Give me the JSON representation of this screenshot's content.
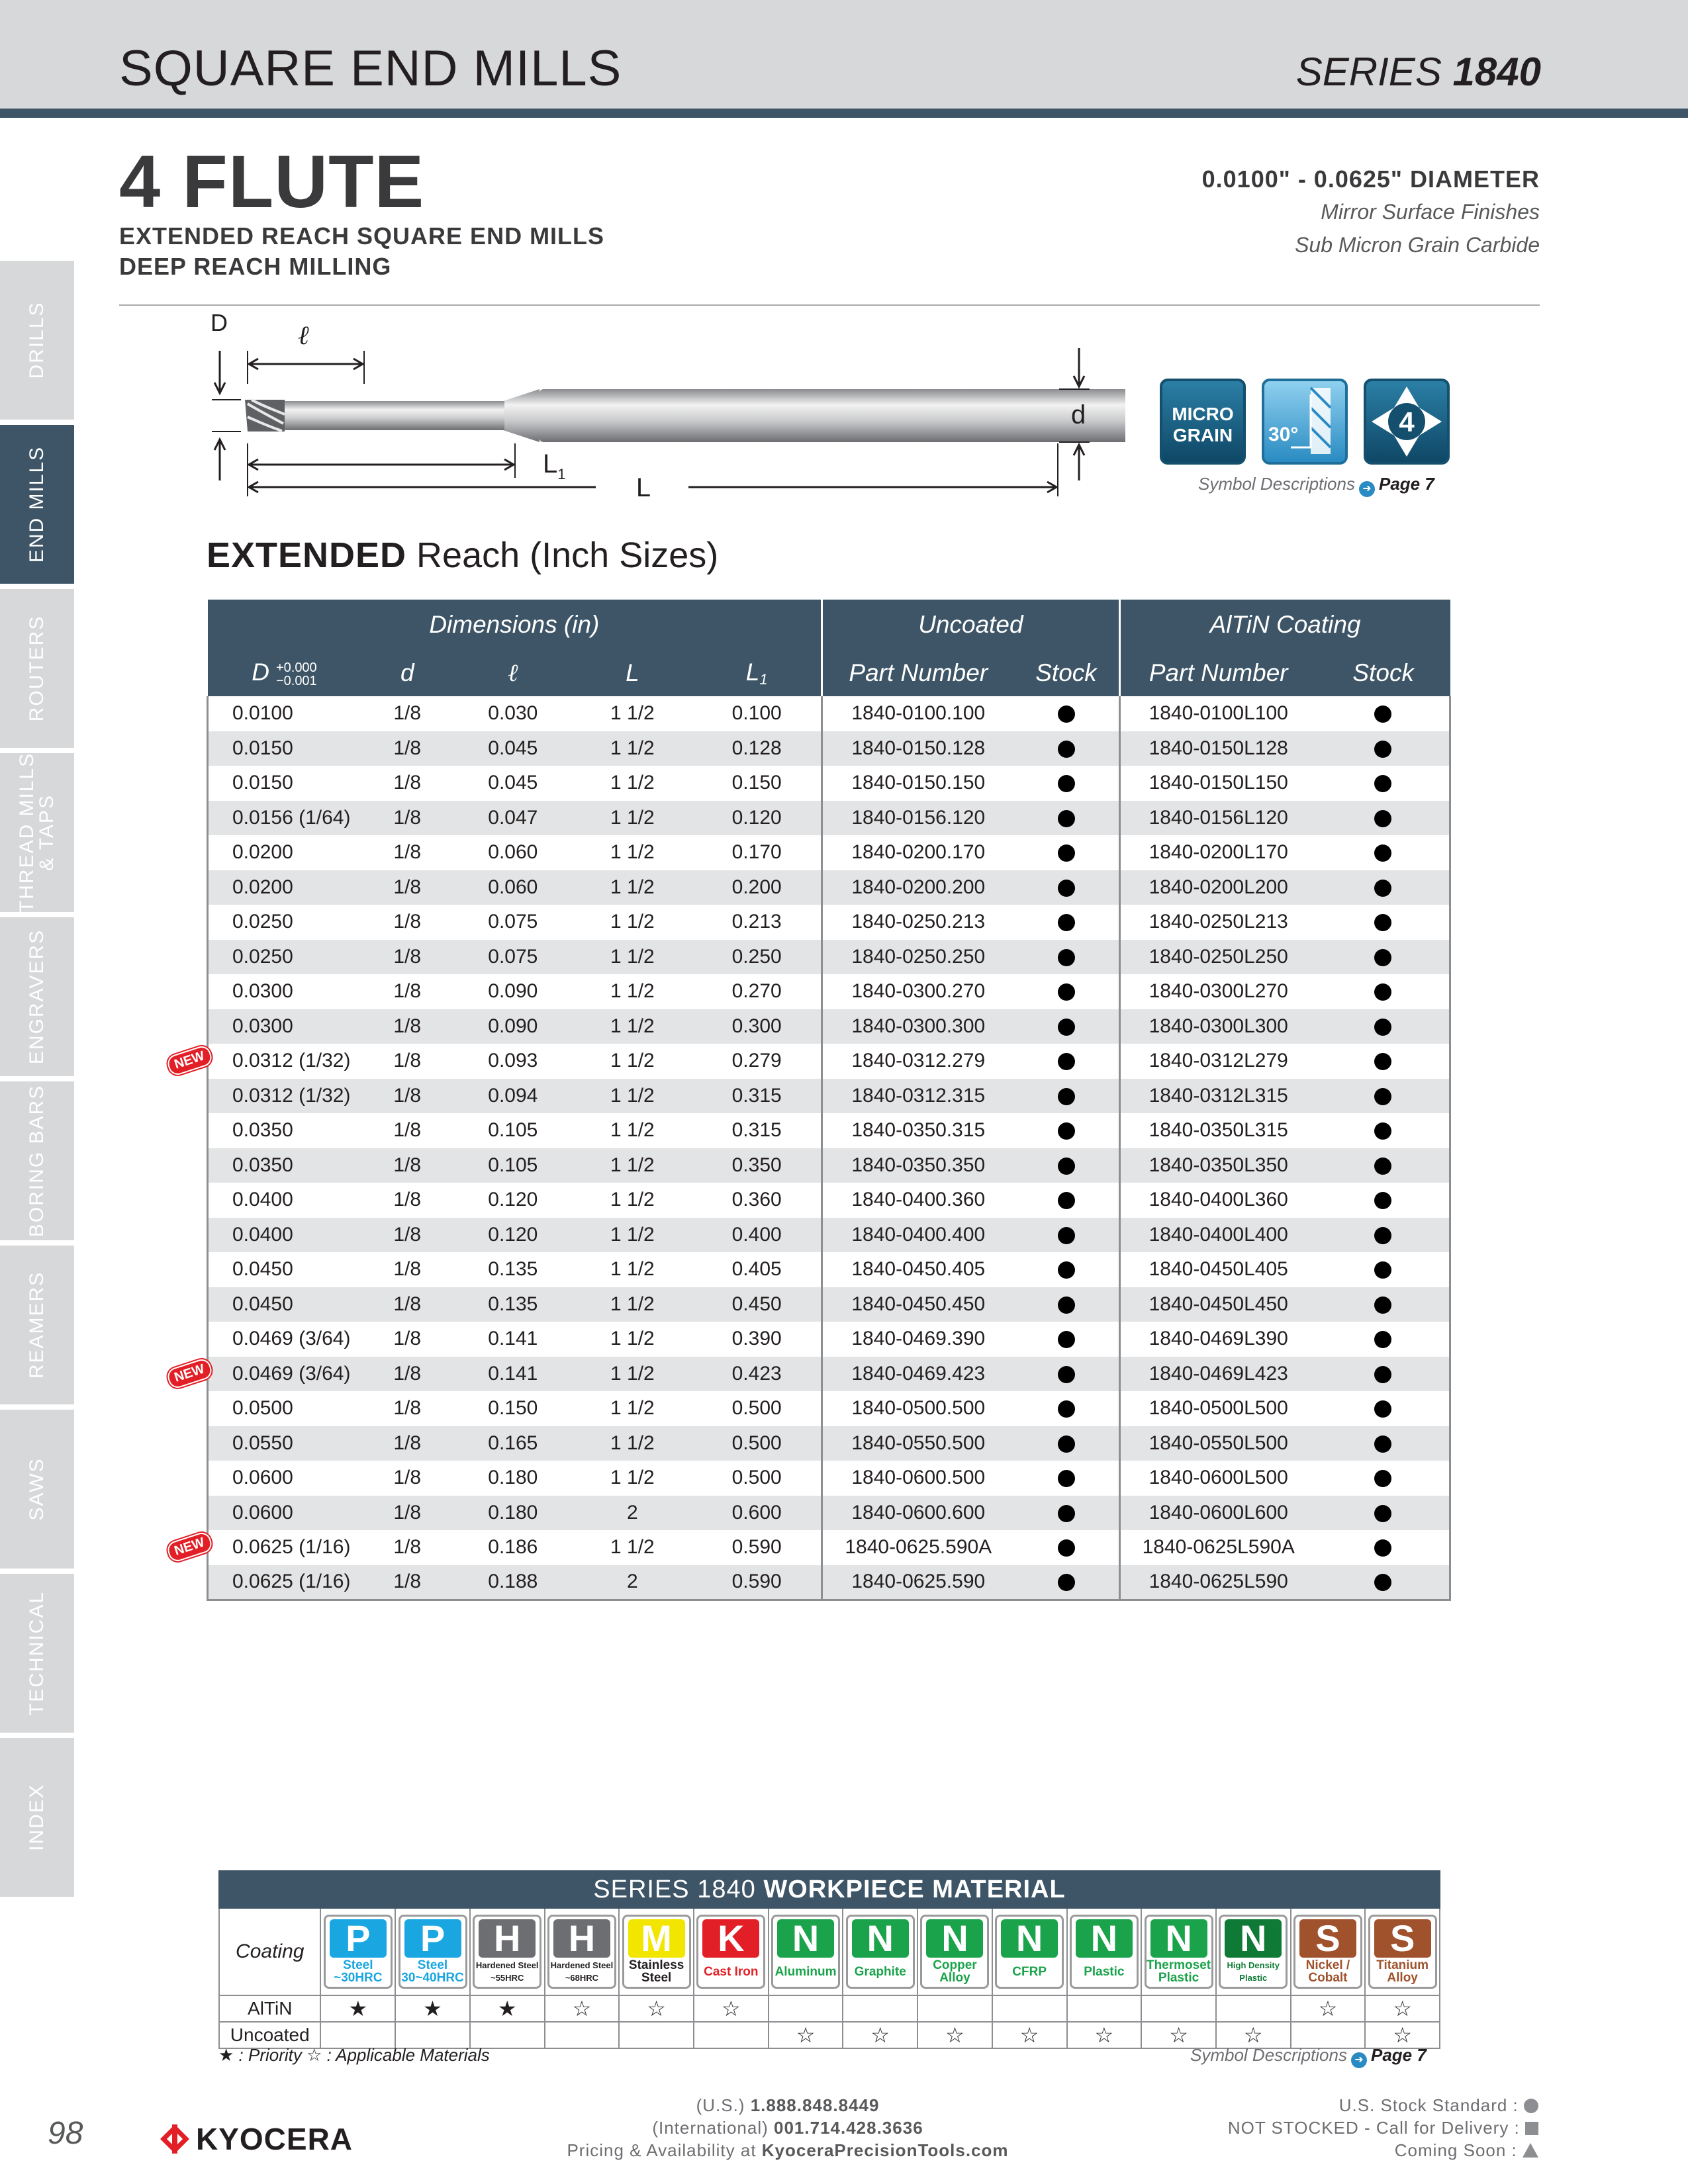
{
  "header": {
    "title": "SQUARE END MILLS",
    "series_prefix": "SERIES",
    "series_number": "1840"
  },
  "sidebar": [
    {
      "label": "DRILLS",
      "active": false
    },
    {
      "label": "END MILLS",
      "active": true
    },
    {
      "label": "ROUTERS",
      "active": false
    },
    {
      "label": "THREAD MILLS",
      "label2": "& TAPS",
      "active": false
    },
    {
      "label": "ENGRAVERS",
      "active": false
    },
    {
      "label": "BORING BARS",
      "active": false
    },
    {
      "label": "REAMERS",
      "active": false
    },
    {
      "label": "SAWS",
      "active": false
    },
    {
      "label": "TECHNICAL",
      "active": false
    },
    {
      "label": "INDEX",
      "active": false
    }
  ],
  "product": {
    "title": "4 FLUTE",
    "subtitle1": "EXTENDED REACH SQUARE END MILLS",
    "subtitle2": "DEEP REACH MILLING",
    "diameter": "0.0100\" - 0.0625\" DIAMETER",
    "feature1": "Mirror Surface Finishes",
    "feature2": "Sub Micron Grain Carbide"
  },
  "diagram": {
    "D": "D",
    "ell": "ℓ",
    "d": "d",
    "L1": "L",
    "L1_sub": "1",
    "L": "L"
  },
  "symbols": {
    "micro_line1": "MICRO",
    "micro_line2": "GRAIN",
    "helix": "30°",
    "flutes": "4",
    "note": "Symbol Descriptions",
    "page": "Page 7"
  },
  "section": {
    "bold": "EXTENDED",
    "rest": " Reach (Inch Sizes)"
  },
  "table": {
    "group_headers": [
      "Dimensions (in)",
      "Uncoated",
      "AlTiN Coating"
    ],
    "col_D": "D",
    "tol_plus": "+0.000",
    "tol_minus": "−0.001",
    "col_d": "d",
    "col_ell": "ℓ",
    "col_L": "L",
    "col_L1": "L",
    "col_L1_sub": "1",
    "col_part": "Part Number",
    "col_stock": "Stock",
    "new_label": "NEW",
    "rows": [
      {
        "D": "0.0100",
        "d": "1/8",
        "ell": "0.030",
        "L": "1 1/2",
        "L1": "0.100",
        "unc": "1840-0100.100",
        "alt": "1840-0100L100",
        "new": false
      },
      {
        "D": "0.0150",
        "d": "1/8",
        "ell": "0.045",
        "L": "1 1/2",
        "L1": "0.128",
        "unc": "1840-0150.128",
        "alt": "1840-0150L128",
        "new": false
      },
      {
        "D": "0.0150",
        "d": "1/8",
        "ell": "0.045",
        "L": "1 1/2",
        "L1": "0.150",
        "unc": "1840-0150.150",
        "alt": "1840-0150L150",
        "new": false
      },
      {
        "D": "0.0156 (1/64)",
        "d": "1/8",
        "ell": "0.047",
        "L": "1 1/2",
        "L1": "0.120",
        "unc": "1840-0156.120",
        "alt": "1840-0156L120",
        "new": false
      },
      {
        "D": "0.0200",
        "d": "1/8",
        "ell": "0.060",
        "L": "1 1/2",
        "L1": "0.170",
        "unc": "1840-0200.170",
        "alt": "1840-0200L170",
        "new": false
      },
      {
        "D": "0.0200",
        "d": "1/8",
        "ell": "0.060",
        "L": "1 1/2",
        "L1": "0.200",
        "unc": "1840-0200.200",
        "alt": "1840-0200L200",
        "new": false
      },
      {
        "D": "0.0250",
        "d": "1/8",
        "ell": "0.075",
        "L": "1 1/2",
        "L1": "0.213",
        "unc": "1840-0250.213",
        "alt": "1840-0250L213",
        "new": false
      },
      {
        "D": "0.0250",
        "d": "1/8",
        "ell": "0.075",
        "L": "1 1/2",
        "L1": "0.250",
        "unc": "1840-0250.250",
        "alt": "1840-0250L250",
        "new": false
      },
      {
        "D": "0.0300",
        "d": "1/8",
        "ell": "0.090",
        "L": "1 1/2",
        "L1": "0.270",
        "unc": "1840-0300.270",
        "alt": "1840-0300L270",
        "new": false
      },
      {
        "D": "0.0300",
        "d": "1/8",
        "ell": "0.090",
        "L": "1 1/2",
        "L1": "0.300",
        "unc": "1840-0300.300",
        "alt": "1840-0300L300",
        "new": false
      },
      {
        "D": "0.0312 (1/32)",
        "d": "1/8",
        "ell": "0.093",
        "L": "1 1/2",
        "L1": "0.279",
        "unc": "1840-0312.279",
        "alt": "1840-0312L279",
        "new": true
      },
      {
        "D": "0.0312 (1/32)",
        "d": "1/8",
        "ell": "0.094",
        "L": "1 1/2",
        "L1": "0.315",
        "unc": "1840-0312.315",
        "alt": "1840-0312L315",
        "new": false
      },
      {
        "D": "0.0350",
        "d": "1/8",
        "ell": "0.105",
        "L": "1 1/2",
        "L1": "0.315",
        "unc": "1840-0350.315",
        "alt": "1840-0350L315",
        "new": false
      },
      {
        "D": "0.0350",
        "d": "1/8",
        "ell": "0.105",
        "L": "1 1/2",
        "L1": "0.350",
        "unc": "1840-0350.350",
        "alt": "1840-0350L350",
        "new": false
      },
      {
        "D": "0.0400",
        "d": "1/8",
        "ell": "0.120",
        "L": "1 1/2",
        "L1": "0.360",
        "unc": "1840-0400.360",
        "alt": "1840-0400L360",
        "new": false
      },
      {
        "D": "0.0400",
        "d": "1/8",
        "ell": "0.120",
        "L": "1 1/2",
        "L1": "0.400",
        "unc": "1840-0400.400",
        "alt": "1840-0400L400",
        "new": false
      },
      {
        "D": "0.0450",
        "d": "1/8",
        "ell": "0.135",
        "L": "1 1/2",
        "L1": "0.405",
        "unc": "1840-0450.405",
        "alt": "1840-0450L405",
        "new": false
      },
      {
        "D": "0.0450",
        "d": "1/8",
        "ell": "0.135",
        "L": "1 1/2",
        "L1": "0.450",
        "unc": "1840-0450.450",
        "alt": "1840-0450L450",
        "new": false
      },
      {
        "D": "0.0469 (3/64)",
        "d": "1/8",
        "ell": "0.141",
        "L": "1 1/2",
        "L1": "0.390",
        "unc": "1840-0469.390",
        "alt": "1840-0469L390",
        "new": false
      },
      {
        "D": "0.0469 (3/64)",
        "d": "1/8",
        "ell": "0.141",
        "L": "1 1/2",
        "L1": "0.423",
        "unc": "1840-0469.423",
        "alt": "1840-0469L423",
        "new": true
      },
      {
        "D": "0.0500",
        "d": "1/8",
        "ell": "0.150",
        "L": "1 1/2",
        "L1": "0.500",
        "unc": "1840-0500.500",
        "alt": "1840-0500L500",
        "new": false
      },
      {
        "D": "0.0550",
        "d": "1/8",
        "ell": "0.165",
        "L": "1 1/2",
        "L1": "0.500",
        "unc": "1840-0550.500",
        "alt": "1840-0550L500",
        "new": false
      },
      {
        "D": "0.0600",
        "d": "1/8",
        "ell": "0.180",
        "L": "1 1/2",
        "L1": "0.500",
        "unc": "1840-0600.500",
        "alt": "1840-0600L500",
        "new": false
      },
      {
        "D": "0.0600",
        "d": "1/8",
        "ell": "0.180",
        "L": "2",
        "L1": "0.600",
        "unc": "1840-0600.600",
        "alt": "1840-0600L600",
        "new": false
      },
      {
        "D": "0.0625 (1/16)",
        "d": "1/8",
        "ell": "0.186",
        "L": "1 1/2",
        "L1": "0.590",
        "unc": "1840-0625.590A",
        "alt": "1840-0625L590A",
        "new": true
      },
      {
        "D": "0.0625 (1/16)",
        "d": "1/8",
        "ell": "0.188",
        "L": "2",
        "L1": "0.590",
        "unc": "1840-0625.590",
        "alt": "1840-0625L590",
        "new": false
      }
    ]
  },
  "workpiece": {
    "head_prefix": "SERIES 1840",
    "head_bold": "WORKPIECE MATERIAL",
    "coating_label": "Coating",
    "rows_labels": [
      "AlTiN",
      "Uncoated"
    ],
    "materials": [
      {
        "letter": "P",
        "name": "Steel",
        "name2": "~30HRC",
        "color": "#1aa6e0",
        "text_color": "#1aa6e0",
        "altin": "★",
        "unc": ""
      },
      {
        "letter": "P",
        "name": "Steel",
        "name2": "30~40HRC",
        "color": "#1aa6e0",
        "text_color": "#1aa6e0",
        "altin": "★",
        "unc": ""
      },
      {
        "letter": "H",
        "name": "Hardened Steel",
        "name2": "~55HRC",
        "color": "#6d6e71",
        "text_color": "#231f20",
        "altin": "★",
        "unc": ""
      },
      {
        "letter": "H",
        "name": "Hardened Steel",
        "name2": "~68HRC",
        "color": "#6d6e71",
        "text_color": "#231f20",
        "altin": "☆",
        "unc": ""
      },
      {
        "letter": "M",
        "name": "Stainless",
        "name2": "Steel",
        "color": "#f2e600",
        "text_color": "#231f20",
        "altin": "☆",
        "unc": ""
      },
      {
        "letter": "K",
        "name": "Cast Iron",
        "name2": "",
        "color": "#e21f26",
        "text_color": "#e21f26",
        "altin": "☆",
        "unc": ""
      },
      {
        "letter": "N",
        "name": "Aluminum",
        "name2": "",
        "color": "#1aa34a",
        "text_color": "#1aa34a",
        "altin": "",
        "unc": "☆"
      },
      {
        "letter": "N",
        "name": "Graphite",
        "name2": "",
        "color": "#1aa34a",
        "text_color": "#1aa34a",
        "altin": "",
        "unc": "☆"
      },
      {
        "letter": "N",
        "name": "Copper",
        "name2": "Alloy",
        "color": "#1aa34a",
        "text_color": "#1aa34a",
        "altin": "",
        "unc": "☆"
      },
      {
        "letter": "N",
        "name": "CFRP",
        "name2": "",
        "color": "#1aa34a",
        "text_color": "#1aa34a",
        "altin": "",
        "unc": "☆"
      },
      {
        "letter": "N",
        "name": "Plastic",
        "name2": "",
        "color": "#1aa34a",
        "text_color": "#1aa34a",
        "altin": "",
        "unc": "☆"
      },
      {
        "letter": "N",
        "name": "Thermoset",
        "name2": "Plastic",
        "color": "#1aa34a",
        "text_color": "#1aa34a",
        "altin": "",
        "unc": "☆"
      },
      {
        "letter": "N",
        "name": "High Density",
        "name2": "Plastic",
        "color": "#0f7a36",
        "text_color": "#0f7a36",
        "altin": "",
        "unc": "☆"
      },
      {
        "letter": "S",
        "name": "Nickel /",
        "name2": "Cobalt",
        "color": "#a0522d",
        "text_color": "#a0522d",
        "altin": "☆",
        "unc": ""
      },
      {
        "letter": "S",
        "name": "Titanium",
        "name2": "Alloy",
        "color": "#a0522d",
        "text_color": "#a0522d",
        "altin": "☆",
        "unc": "☆"
      }
    ],
    "legend": "★ : Priority  ☆ : Applicable Materials",
    "note": "Symbol Descriptions",
    "page": "Page 7"
  },
  "footer": {
    "page_number": "98",
    "brand": "KYOCERA",
    "us_label": "(U.S.)",
    "us_phone": "1.888.848.8449",
    "intl_label": "(International)",
    "intl_phone": "001.714.428.3636",
    "pricing_label": "Pricing & Availability at",
    "pricing_site": "KyoceraPrecisionTools.com",
    "stock_standard": "U.S. Stock Standard :",
    "not_stocked": "NOT STOCKED - Call for Delivery :",
    "coming_soon": "Coming Soon :"
  }
}
